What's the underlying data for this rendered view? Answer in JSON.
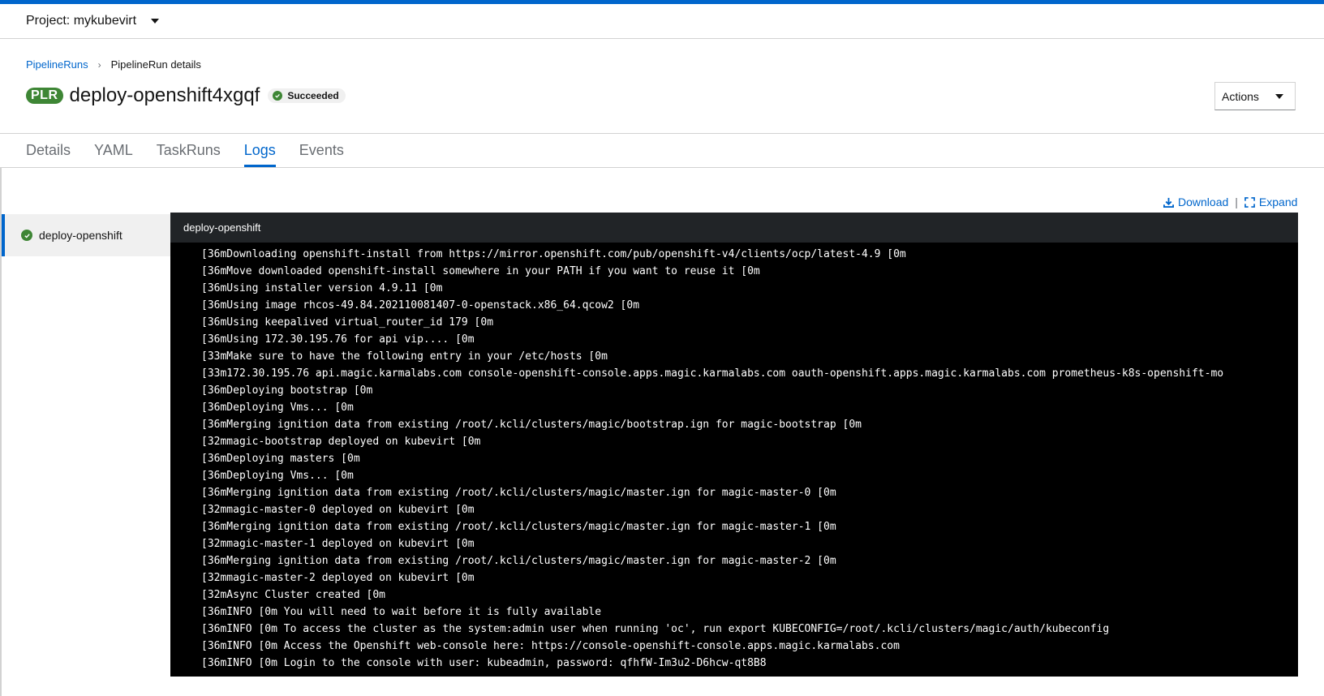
{
  "project": {
    "label": "Project: mykubevirt"
  },
  "breadcrumb": {
    "parent": "PipelineRuns",
    "separator": "›",
    "current": "PipelineRun details"
  },
  "header": {
    "badge": "PLR",
    "title": "deploy-openshift4xgqf",
    "status": "Succeeded",
    "actions_label": "Actions"
  },
  "tabs": [
    {
      "label": "Details"
    },
    {
      "label": "YAML"
    },
    {
      "label": "TaskRuns"
    },
    {
      "label": "Logs"
    },
    {
      "label": "Events"
    }
  ],
  "log_links": {
    "download": "Download",
    "divider": "|",
    "expand": "Expand"
  },
  "task_list": [
    {
      "name": "deploy-openshift"
    }
  ],
  "log": {
    "title": "deploy-openshift",
    "lines": [
      "[36mDownloading openshift-install from https://mirror.openshift.com/pub/openshift-v4/clients/ocp/latest-4.9 [0m",
      "[36mMove downloaded openshift-install somewhere in your PATH if you want to reuse it [0m",
      "[36mUsing installer version 4.9.11 [0m",
      "[36mUsing image rhcos-49.84.202110081407-0-openstack.x86_64.qcow2 [0m",
      "[36mUsing keepalived virtual_router_id 179 [0m",
      "[36mUsing 172.30.195.76 for api vip.... [0m",
      "[33mMake sure to have the following entry in your /etc/hosts [0m",
      "[33m172.30.195.76 api.magic.karmalabs.com console-openshift-console.apps.magic.karmalabs.com oauth-openshift.apps.magic.karmalabs.com prometheus-k8s-openshift-mo",
      "[36mDeploying bootstrap [0m",
      "[36mDeploying Vms... [0m",
      "[36mMerging ignition data from existing /root/.kcli/clusters/magic/bootstrap.ign for magic-bootstrap [0m",
      "[32mmagic-bootstrap deployed on kubevirt [0m",
      "[36mDeploying masters [0m",
      "[36mDeploying Vms... [0m",
      "[36mMerging ignition data from existing /root/.kcli/clusters/magic/master.ign for magic-master-0 [0m",
      "[32mmagic-master-0 deployed on kubevirt [0m",
      "[36mMerging ignition data from existing /root/.kcli/clusters/magic/master.ign for magic-master-1 [0m",
      "[32mmagic-master-1 deployed on kubevirt [0m",
      "[36mMerging ignition data from existing /root/.kcli/clusters/magic/master.ign for magic-master-2 [0m",
      "[32mmagic-master-2 deployed on kubevirt [0m",
      "[32mAsync Cluster created [0m",
      "[36mINFO [0m You will need to wait before it is fully available",
      "[36mINFO [0m To access the cluster as the system:admin user when running 'oc', run export KUBECONFIG=/root/.kcli/clusters/magic/auth/kubeconfig",
      "[36mINFO [0m Access the Openshift web-console here: https://console-openshift-console.apps.magic.karmalabs.com",
      "[36mINFO [0m Login to the console with user: kubeadmin, password: qfhfW-Im3u2-D6hcw-qt8B8"
    ]
  },
  "colors": {
    "accent": "#0066cc",
    "success": "#3e8635",
    "log_bg": "#000000",
    "log_header_bg": "#212427"
  }
}
